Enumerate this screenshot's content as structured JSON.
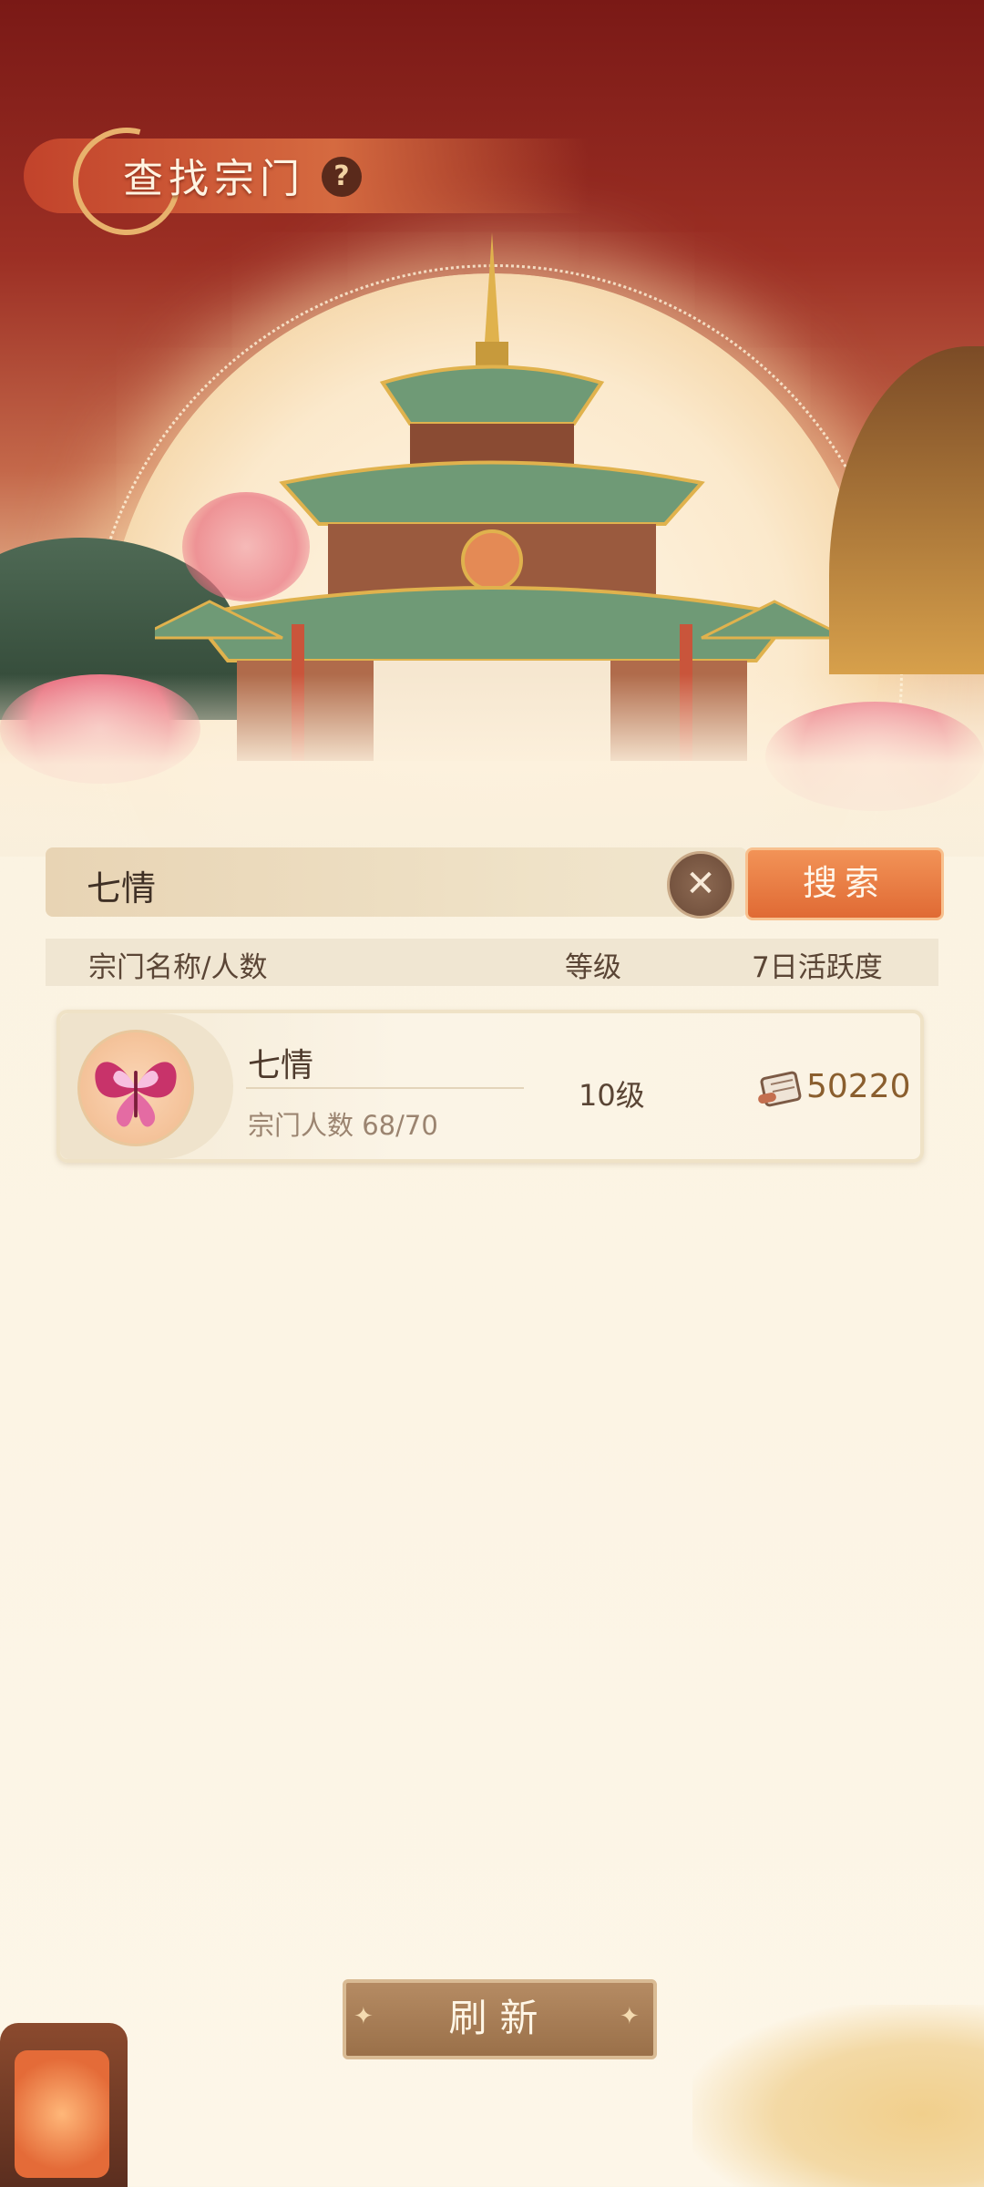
{
  "header": {
    "title": "查找宗门",
    "help_icon": "?"
  },
  "search": {
    "value": "七情",
    "clear_icon": "✕",
    "button_label": "搜索"
  },
  "table": {
    "col_name": "宗门名称/人数",
    "col_level": "等级",
    "col_activity": "7日活跃度"
  },
  "clans": [
    {
      "name": "七情",
      "members": "宗门人数 68/70",
      "level": "10级",
      "activity": "50220"
    }
  ],
  "footer": {
    "refresh_label": "刷新"
  },
  "colors": {
    "accent": "#e06a34",
    "banner": "#9c2f24",
    "panel": "#fbf3e2"
  }
}
